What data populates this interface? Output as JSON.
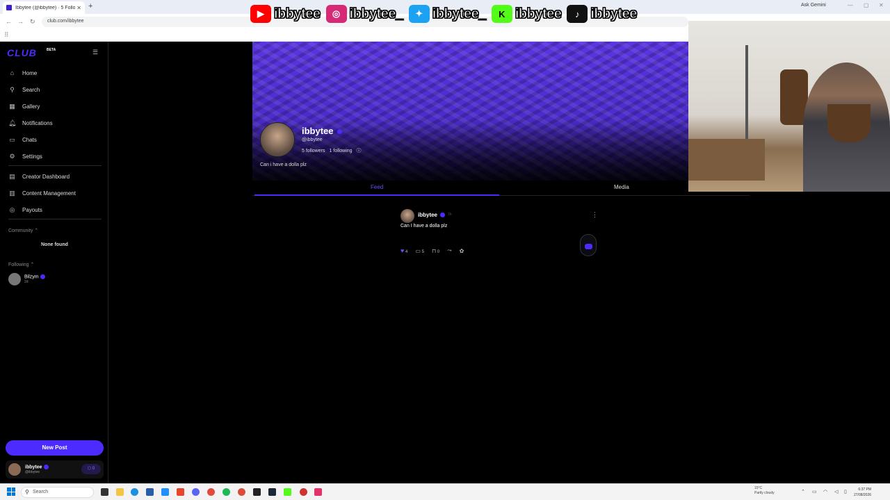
{
  "browser": {
    "tab_title": "Ibbytee (@ibbytee) · 5 Followers",
    "new_tab": "+",
    "ask_gemini": "Ask Gemini",
    "url": "club.com/ibbytee"
  },
  "overlay": {
    "handles": [
      "ibbytee",
      "ibbytee_",
      "ibbytee_",
      "ibbytee",
      "ibbytee"
    ],
    "icons": [
      "youtube-icon",
      "instagram-icon",
      "twitter-icon",
      "kick-icon",
      "tiktok-icon"
    ],
    "colors": [
      "#ff0000",
      "#d62976",
      "#1da1f2",
      "#53fc18",
      "#111111"
    ]
  },
  "sidebar": {
    "logo": "CLUB",
    "beta": "BETA",
    "nav": [
      {
        "label": "Home",
        "icon": "home-icon"
      },
      {
        "label": "Search",
        "icon": "search-icon"
      },
      {
        "label": "Gallery",
        "icon": "gallery-icon"
      },
      {
        "label": "Notifications",
        "icon": "bell-icon"
      },
      {
        "label": "Chats",
        "icon": "chat-icon"
      },
      {
        "label": "Settings",
        "icon": "gear-icon"
      }
    ],
    "creator_nav": [
      {
        "label": "Creator Dashboard",
        "icon": "dashboard-icon"
      },
      {
        "label": "Content Management",
        "icon": "content-icon"
      },
      {
        "label": "Payouts",
        "icon": "payout-icon"
      }
    ],
    "community_label": "Community",
    "community_empty": "None found",
    "following_label": "Following",
    "following": [
      {
        "name": "Bilzym",
        "time": "2d"
      }
    ],
    "new_post": "New Post",
    "me": {
      "name": "ibbytee",
      "handle": "@ibbytee",
      "coins": "0"
    }
  },
  "profile": {
    "name": "ibbytee",
    "handle": "@ibbytee",
    "followers": "5 followers",
    "following": "1 following",
    "bio": "Can i have a dolla plz"
  },
  "tabs": {
    "feed": "Feed",
    "media": "Media"
  },
  "post": {
    "author": "ibbytee",
    "time": "1h",
    "text": "Can I have a dolla plz",
    "likes": "4",
    "comments": "5",
    "saves": "0"
  },
  "taskbar": {
    "search": "Search",
    "weather_temp": "15°C",
    "weather_desc": "Partly cloudy",
    "time": "6:37 PM",
    "date": "27/08/2026"
  },
  "accent": "#4c2bff"
}
